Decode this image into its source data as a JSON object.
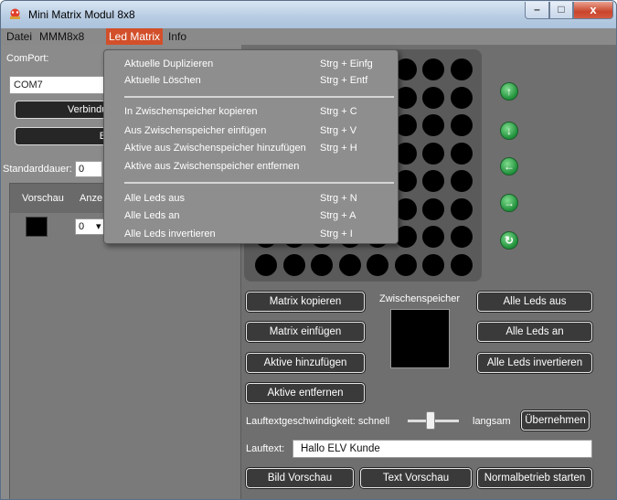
{
  "window": {
    "title": "Mini Matrix Modul 8x8",
    "controls": {
      "minimize": "–",
      "maximize": "□",
      "close": "x"
    }
  },
  "menubar": {
    "items": [
      "Datei",
      "MMM8x8",
      "Led Matrix",
      "Info"
    ],
    "active": "Led Matrix"
  },
  "left_panel": {
    "comport_label": "ComPort:",
    "comport_value": "COM7",
    "connect_button": "Verbindur",
    "image_button": "Bil",
    "default_duration_label": "Standarddauer:",
    "default_duration_value": "0",
    "preview_header": "Vorschau",
    "count_header": "Anze",
    "count_value": "0"
  },
  "menu_led_matrix": {
    "groups": [
      [
        {
          "label": "Aktuelle Duplizieren",
          "shortcut": "Strg + Einfg"
        },
        {
          "label": "Aktuelle Löschen",
          "shortcut": "Strg + Entf"
        }
      ],
      [
        {
          "label": "In Zwischenspeicher kopieren",
          "shortcut": "Strg + C"
        },
        {
          "label": "Aus Zwischenspeicher einfügen",
          "shortcut": "Strg + V"
        },
        {
          "label": "Aktive aus Zwischenspeicher hinzufügen",
          "shortcut": "Strg + H"
        },
        {
          "label": "Aktive aus Zwischenspeicher entfernen",
          "shortcut": ""
        }
      ],
      [
        {
          "label": "Alle Leds aus",
          "shortcut": "Strg + N"
        },
        {
          "label": "Alle Leds an",
          "shortcut": "Strg + A"
        },
        {
          "label": "Alle Leds invertieren",
          "shortcut": "Strg + I"
        }
      ]
    ]
  },
  "matrix": {
    "rows": 8,
    "cols": 8,
    "led_color": "#000000"
  },
  "arrows": [
    "arrow-up-icon",
    "arrow-down-icon",
    "arrow-left-icon",
    "arrow-right-icon",
    "rotate-icon"
  ],
  "buttons": {
    "matrix_copy": "Matrix kopieren",
    "matrix_paste": "Matrix einfügen",
    "active_add": "Aktive hinzufügen",
    "active_remove": "Aktive entfernen",
    "clipboard_label": "Zwischenspeicher",
    "all_off": "Alle Leds aus",
    "all_on": "Alle Leds an",
    "all_invert": "Alle Leds invertieren"
  },
  "scroll_speed": {
    "label": "Lauftextgeschwindigkeit: schnell",
    "slow_label": "langsam",
    "apply_button": "Übernehmen",
    "level": 0.45
  },
  "scroll_text": {
    "label": "Lauftext:",
    "value": "Hallo ELV Kunde"
  },
  "bottom_buttons": {
    "image_preview": "Bild Vorschau",
    "text_preview": "Text Vorschau",
    "normal_mode": "Normalbetrieb starten"
  },
  "colors": {
    "accent": "#d24f2a",
    "arrow_green": "#2a9a45",
    "panel": "#6f6f6f"
  }
}
